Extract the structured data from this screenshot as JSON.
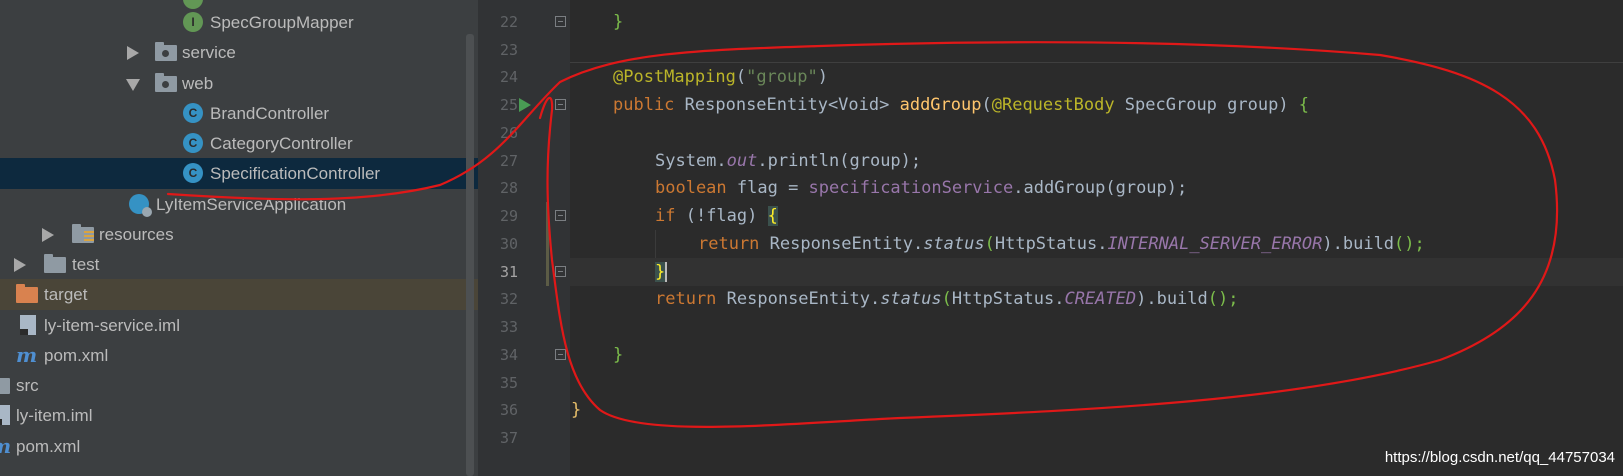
{
  "project_tree": {
    "items": [
      {
        "label": "SpecGroupMapper",
        "icon": "interface-icon"
      },
      {
        "label": "service",
        "icon": "package-folder-icon"
      },
      {
        "label": "web",
        "icon": "package-folder-icon"
      },
      {
        "label": "BrandController",
        "icon": "class-icon"
      },
      {
        "label": "CategoryController",
        "icon": "class-icon"
      },
      {
        "label": "SpecificationController",
        "icon": "class-icon"
      },
      {
        "label": "LyItemServiceApplication",
        "icon": "spring-boot-app-icon"
      },
      {
        "label": "resources",
        "icon": "resources-folder-icon"
      },
      {
        "label": "test",
        "icon": "folder-icon"
      },
      {
        "label": "target",
        "icon": "excluded-folder-icon"
      },
      {
        "label": "ly-item-service.iml",
        "icon": "iml-file-icon"
      },
      {
        "label": "pom.xml",
        "icon": "maven-icon"
      },
      {
        "label": "src",
        "icon": "folder-icon"
      },
      {
        "label": "ly-item.iml",
        "icon": "iml-file-icon"
      },
      {
        "label": "pom.xml",
        "icon": "maven-icon"
      }
    ],
    "class_glyph": "C",
    "interface_glyph": "I",
    "selected_item": "SpecificationController"
  },
  "editor": {
    "line_numbers": [
      "22",
      "23",
      "24",
      "25",
      "26",
      "27",
      "28",
      "29",
      "30",
      "31",
      "32",
      "33",
      "34",
      "35",
      "36",
      "37"
    ],
    "current_line": "31",
    "code": {
      "l22_brace": "}",
      "l24_annotation": "@PostMapping",
      "l24_open": "(",
      "l24_string": "\"group\"",
      "l24_close": ")",
      "l25_public": "public ",
      "l25_type": "ResponseEntity<Void> ",
      "l25_name": "addGroup",
      "l25_open": "(",
      "l25_annotation": "@RequestBody",
      "l25_params": " SpecGroup group) ",
      "l25_brace": "{",
      "l27_system": "System.",
      "l27_out": "out",
      "l27_rest": ".println(group);",
      "l28_boolean": "boolean ",
      "l28_decl": "flag = ",
      "l28_field": "specificationService",
      "l28_rest": ".addGroup(group);",
      "l29_if": "if ",
      "l29_cond": "(!flag) ",
      "l29_brace": "{",
      "l30_return": "return ",
      "l30_class": "ResponseEntity.",
      "l30_status": "status",
      "l30_open": "(",
      "l30_http": "HttpStatus.",
      "l30_const": "INTERNAL_SERVER_ERROR",
      "l30_rest": ").build",
      "l30_end": "();",
      "l31_brace": "}",
      "l32_return": "return ",
      "l32_class": "ResponseEntity.",
      "l32_status": "status",
      "l32_open": "(",
      "l32_http": "HttpStatus.",
      "l32_const": "CREATED",
      "l32_rest": ").build",
      "l32_end": "();",
      "l34_brace": "}",
      "l36_brace": "}"
    }
  },
  "watermark": "https://blog.csdn.net/qq_44757034",
  "colors": {
    "keyword": "#cc7832",
    "annotation": "#bbb529",
    "string": "#6a8759",
    "method": "#ffc66d",
    "field": "#9876aa",
    "annotation_ink": "#e01818"
  }
}
